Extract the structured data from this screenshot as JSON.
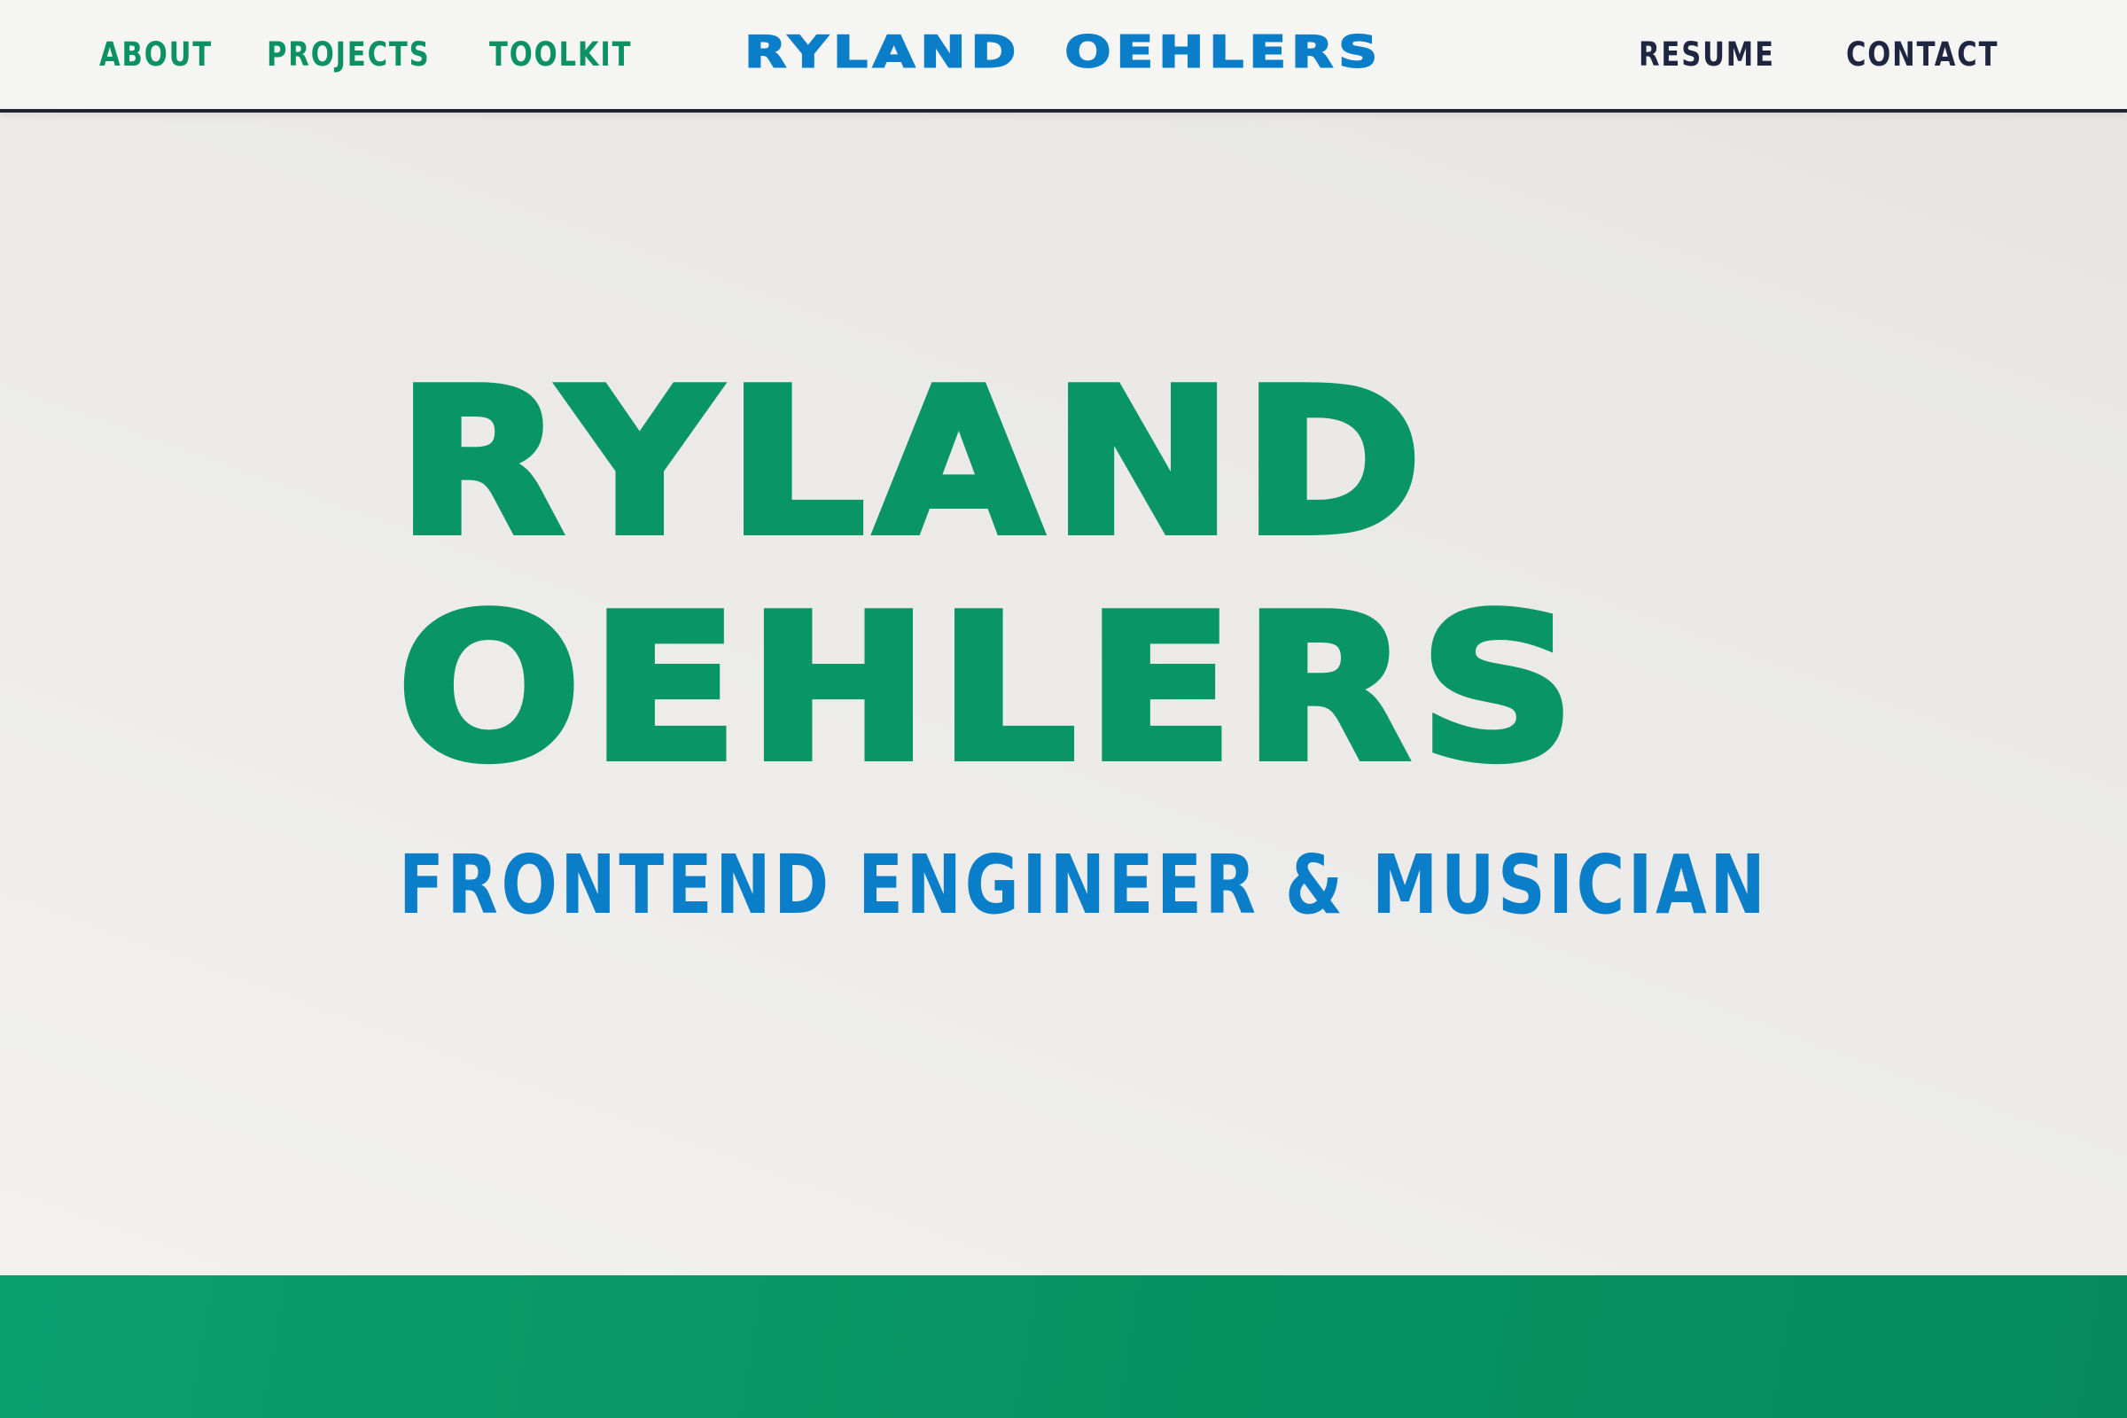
{
  "nav": {
    "left": [
      {
        "label": "ABOUT"
      },
      {
        "label": "PROJECTS"
      },
      {
        "label": "TOOLKIT"
      }
    ],
    "right": [
      {
        "label": "RESUME"
      },
      {
        "label": "CONTACT"
      }
    ],
    "brand": "RYLAND OEHLERS"
  },
  "hero": {
    "line1": "RYLAND",
    "line2": "OEHLERS",
    "subtitle": "FRONTEND ENGINEER & MUSICIAN"
  },
  "colors": {
    "primary_green": "#099566",
    "accent_blue": "#0a7ec8",
    "nav_dark": "#1f2740",
    "nav_border": "#1e2233"
  }
}
